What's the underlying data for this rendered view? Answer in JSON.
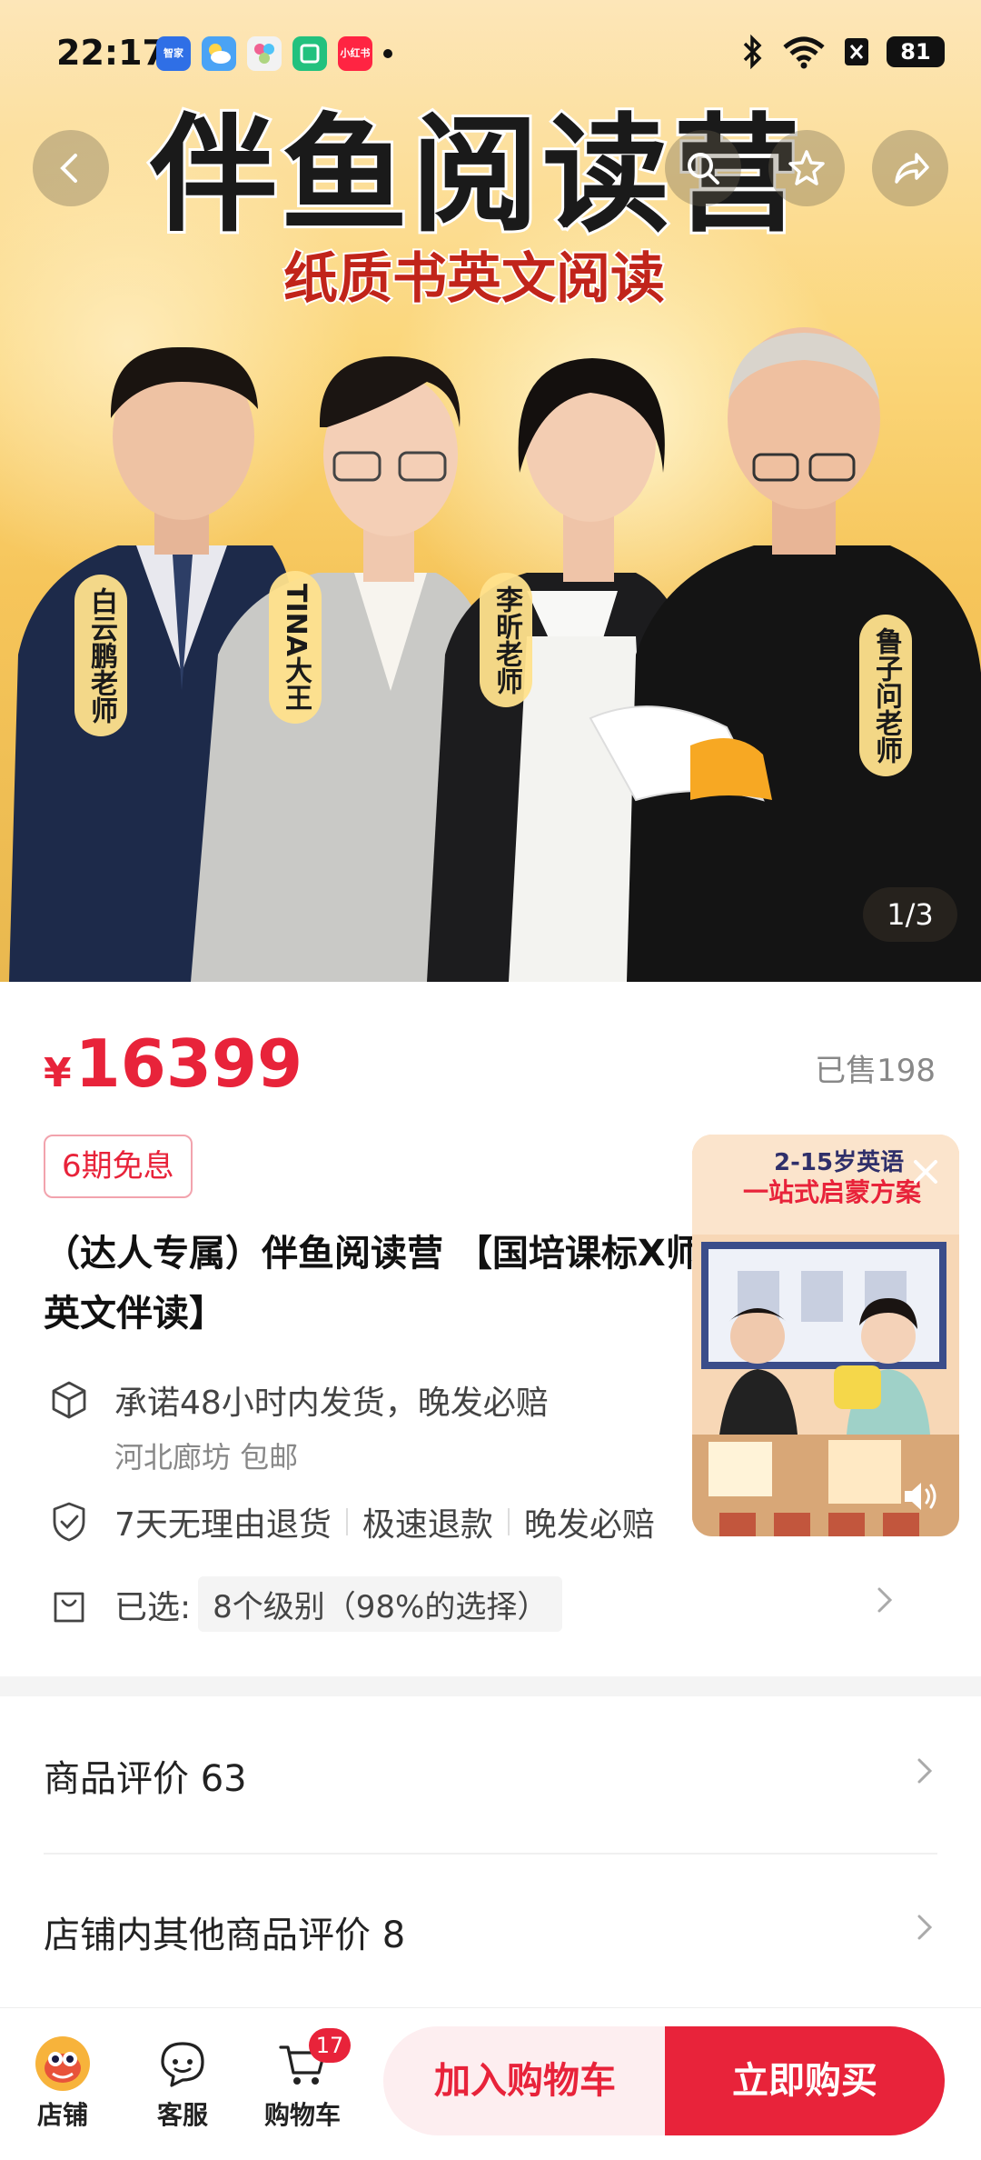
{
  "status_bar": {
    "time": "22:17",
    "apps": [
      {
        "name": "smart-home-app-icon",
        "label": "智家",
        "color": "#2f6fe6"
      },
      {
        "name": "weather-app-icon",
        "label": "",
        "color": "#4aa3f5"
      },
      {
        "name": "ai-app-icon",
        "label": "",
        "color": "#f2f2f2"
      },
      {
        "name": "mi-app-icon",
        "label": "",
        "color": "#22c17e"
      },
      {
        "name": "xiaohongshu-app-icon",
        "label": "小红书",
        "color": "#ff2442"
      }
    ],
    "battery": "81"
  },
  "hero": {
    "title": "伴鱼阅读营",
    "subtitle": "纸质书英文阅读",
    "teachers": [
      {
        "name": "白云鹏老师"
      },
      {
        "name": "TINA大王"
      },
      {
        "name": "李昕老师"
      },
      {
        "name": "鲁子问老师"
      }
    ],
    "pager": "1/3"
  },
  "product": {
    "currency": "¥",
    "price": "16399",
    "sold": "已售198",
    "installment_tag": "6期免息",
    "title": "（达人专属）伴鱼阅读营 【国培课标X师英文伴读】",
    "shipping_promise": "承诺48小时内发货，晚发必赔",
    "ship_from": "河北廊坊 包邮",
    "return_policy": "7天无理由退货",
    "fast_refund": "极速退款",
    "late_compensation": "晚发必赔",
    "selected_label": "已选:",
    "selected_value": "8个级别（98%的选择）"
  },
  "sections": {
    "reviews": "商品评价 63",
    "shop_reviews": "店铺内其他商品评价 8"
  },
  "video": {
    "headline_1": "2-15岁英语",
    "headline_2": "一站式启蒙方案"
  },
  "bottom_bar": {
    "shop": "店铺",
    "service": "客服",
    "cart": "购物车",
    "cart_count": "17",
    "add_to_cart": "加入购物车",
    "buy_now": "立即购买"
  },
  "colors": {
    "accent": "#e8233a",
    "hero_bg": "#f6c55a"
  }
}
